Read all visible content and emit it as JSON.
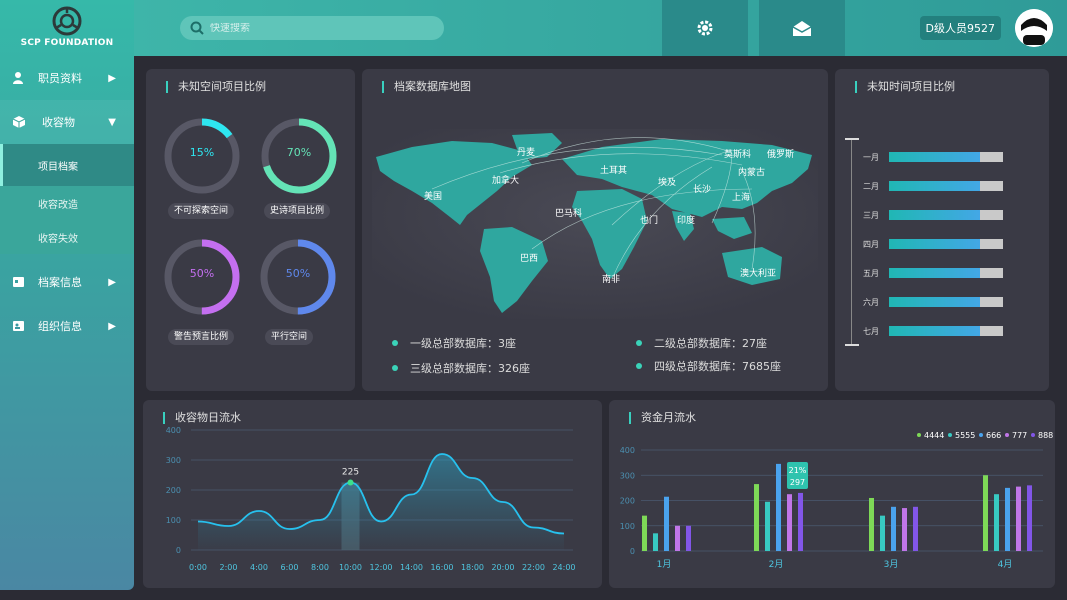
{
  "app": {
    "logo_text": "SCP FOUNDATION"
  },
  "search": {
    "placeholder": "快速搜索"
  },
  "user": {
    "name": "D级人员9527"
  },
  "sidebar": {
    "items": [
      {
        "label": "职员资料",
        "icon": "user-icon"
      },
      {
        "label": "收容物",
        "icon": "box-icon",
        "open": true,
        "children": [
          "项目档案",
          "收容改造",
          "收容失效"
        ]
      },
      {
        "label": "档案信息",
        "icon": "archive-icon"
      },
      {
        "label": "组织信息",
        "icon": "org-icon"
      }
    ]
  },
  "panels": {
    "unknown_space": {
      "title": "未知空间项目比例",
      "donuts": [
        {
          "value": "15%",
          "caption": "不可探索空间",
          "fraction": 0.15,
          "color": "#2ee6f0"
        },
        {
          "value": "70%",
          "caption": "史诗项目比例",
          "fraction": 0.7,
          "color": "#64e3b6"
        },
        {
          "value": "50%",
          "caption": "警告预言比例",
          "fraction": 0.5,
          "color": "#c46ff0"
        },
        {
          "value": "50%",
          "caption": "平行空间",
          "fraction": 0.5,
          "color": "#5f88ec"
        }
      ]
    },
    "map": {
      "title": "档案数据库地图",
      "cities": [
        "丹麦",
        "加拿大",
        "美国",
        "土耳其",
        "巴马科",
        "莫斯科",
        "俄罗斯",
        "内蒙古",
        "埃及",
        "长沙",
        "上海",
        "也门",
        "印度",
        "巴西",
        "南非",
        "澳大利亚"
      ],
      "legend": [
        "一级总部数据库：3座",
        "二级总部数据库：27座",
        "三级总部数据库：326座",
        "四级总部数据库：7685座"
      ]
    },
    "unknown_time": {
      "title": "未知时间项目比例",
      "rows": [
        {
          "label": "一月",
          "fraction": 0.8
        },
        {
          "label": "二月",
          "fraction": 0.8
        },
        {
          "label": "三月",
          "fraction": 0.8
        },
        {
          "label": "四月",
          "fraction": 0.8
        },
        {
          "label": "五月",
          "fraction": 0.8
        },
        {
          "label": "六月",
          "fraction": 0.8
        },
        {
          "label": "七月",
          "fraction": 0.8
        }
      ]
    },
    "daily_flow": {
      "title": "收容物日流水"
    },
    "monthly_funds": {
      "title": "资金月流水",
      "tooltip": [
        "21%",
        "297"
      ]
    }
  },
  "chart_data": [
    {
      "type": "area",
      "x": [
        "0:00",
        "2:00",
        "4:00",
        "6:00",
        "8:00",
        "10:00",
        "12:00",
        "14:00",
        "16:00",
        "18:00",
        "20:00",
        "22:00",
        "24:00"
      ],
      "values": [
        95,
        80,
        130,
        70,
        100,
        225,
        95,
        185,
        320,
        240,
        160,
        75,
        55
      ],
      "ylim": [
        0,
        400
      ],
      "yticks": [
        0,
        100,
        200,
        300,
        400
      ],
      "highlight_label": "225",
      "grid": true
    },
    {
      "type": "bar",
      "categories": [
        "1月",
        "2月",
        "3月",
        "4月"
      ],
      "series": [
        {
          "name": "4444",
          "values": [
            140,
            265,
            210,
            300
          ],
          "color": "#7ed957"
        },
        {
          "name": "5555",
          "values": [
            70,
            195,
            140,
            225
          ],
          "color": "#38c9c2"
        },
        {
          "name": "666",
          "values": [
            215,
            345,
            175,
            250
          ],
          "color": "#4aa3ee"
        },
        {
          "name": "777",
          "values": [
            100,
            225,
            170,
            255
          ],
          "color": "#c176e8"
        },
        {
          "name": "888",
          "values": [
            100,
            230,
            175,
            260
          ],
          "color": "#8256e8"
        }
      ],
      "ylim": [
        0,
        400
      ],
      "yticks": [
        0,
        100,
        200,
        300,
        400
      ],
      "legend": "top-right",
      "grid": true
    }
  ]
}
